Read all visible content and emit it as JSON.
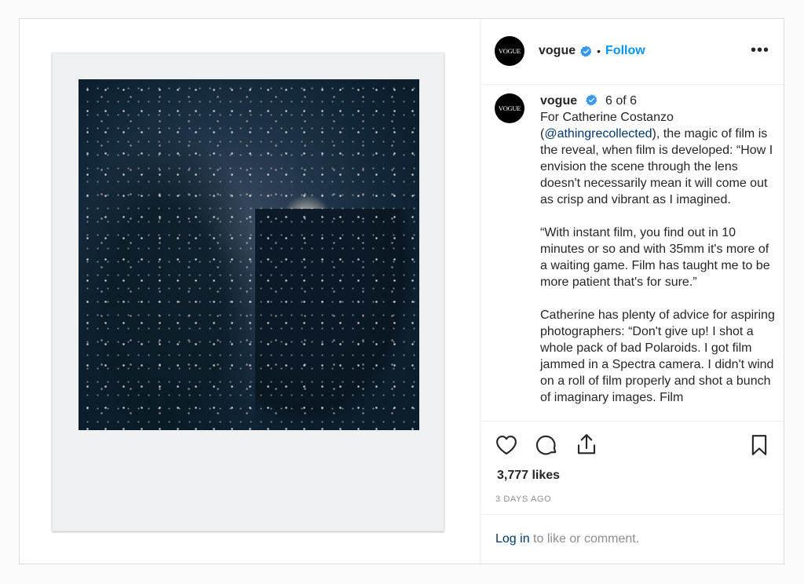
{
  "post": {
    "account": {
      "username": "vogue",
      "avatar_text": "VOGUE",
      "verified": true
    },
    "header": {
      "follow_label": "Follow",
      "separator": "•",
      "more_label": "•••"
    },
    "caption": {
      "username": "vogue",
      "counter": "6 of 6",
      "paragraph1_before": "For Catherine Costanzo (",
      "mention": "@athingrecollected",
      "paragraph1_after": "), the magic of film is the reveal, when film is developed: “How I envision the scene through the lens doesn't necessarily mean it will come out as crisp and vibrant as I imagined.",
      "paragraph2": "“With instant film, you find out in 10 minutes or so and with 35mm it's more of a waiting game. Film has taught me to be more patient that's for sure.”",
      "paragraph3": "Catherine has plenty of advice for aspiring photographers: “Don't give up! I shot a whole pack of bad Polaroids. I got film jammed in a Spectra camera. I didn't wind on a roll of film properly and shot a bunch of imaginary images. Film"
    },
    "actions": {
      "like_icon": "heart-icon",
      "comment_icon": "comment-icon",
      "share_icon": "share-icon",
      "save_icon": "bookmark-icon",
      "likes": "3,777 likes",
      "date": "3 DAYS AGO"
    },
    "login": {
      "link": "Log in",
      "text": " to like or comment."
    }
  },
  "colors": {
    "accent": "#0095f6",
    "verified": "#3897f0",
    "link": "#00376b",
    "muted": "#8e8e8e"
  }
}
